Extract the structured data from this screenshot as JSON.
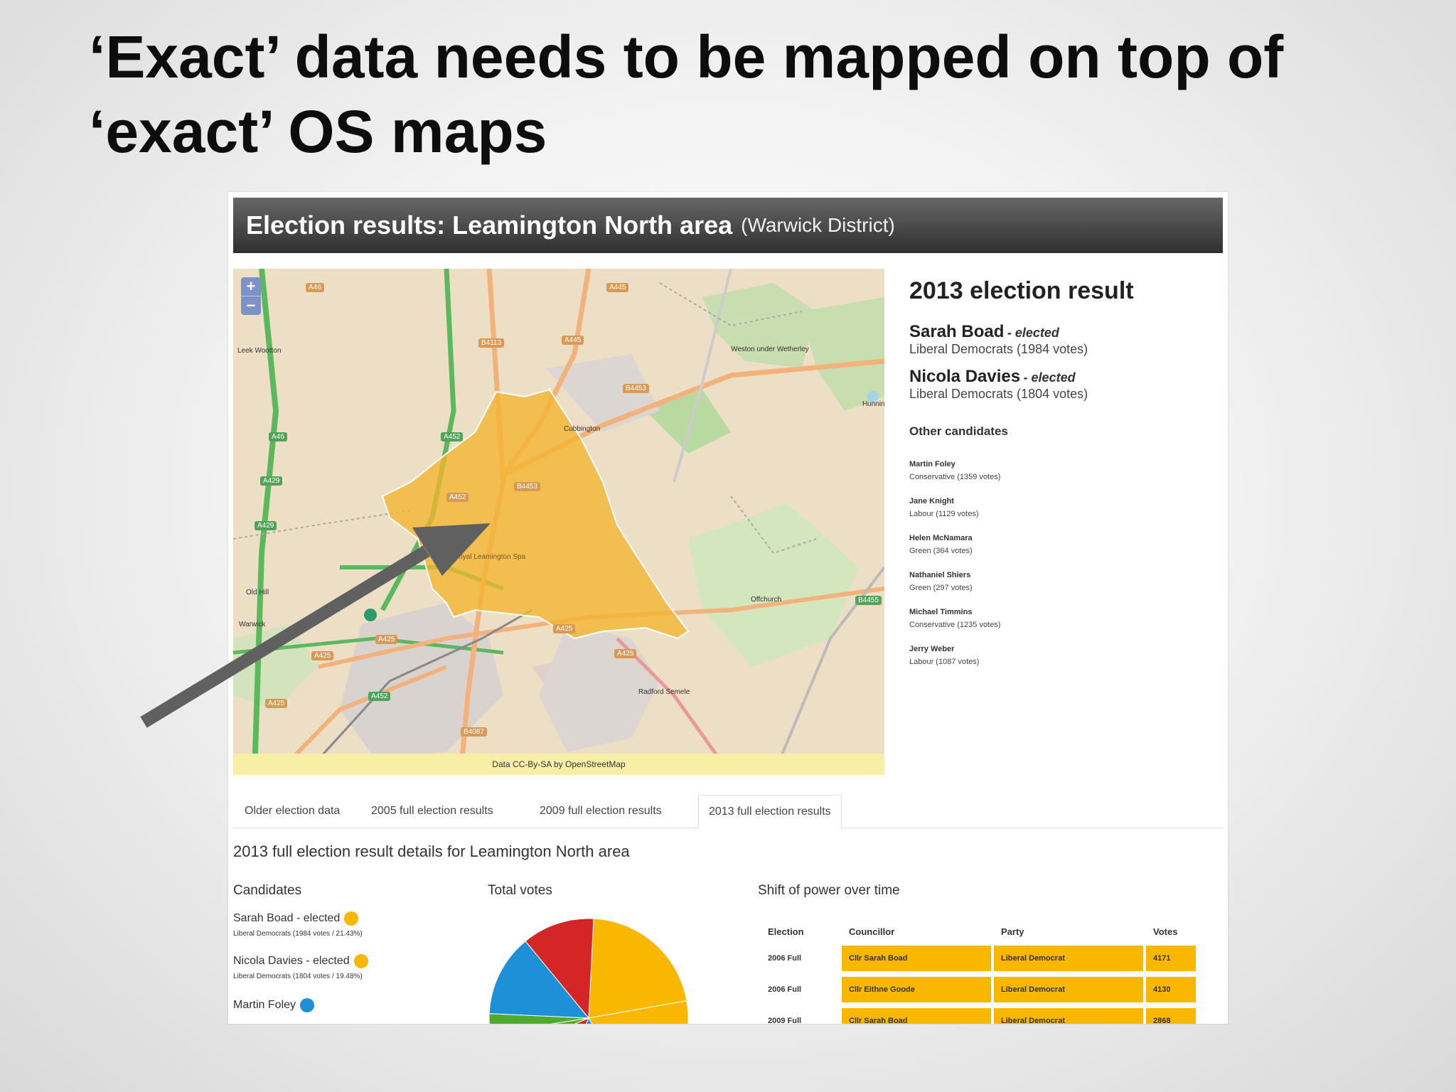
{
  "slide": {
    "title_line1": "‘Exact’ data needs to be mapped on top of",
    "title_line2": "‘exact’ OS maps"
  },
  "header": {
    "title": "Election results: Leamington North area",
    "subtitle": "(Warwick District)"
  },
  "map": {
    "zoom_in": "+",
    "zoom_out": "−",
    "attribution": "Data CC-By-SA by OpenStreetMap",
    "places": [
      "Leek Wootton",
      "Weston under Wetherley",
      "Cubbington",
      "Royal Leamington Spa",
      "Old Hill",
      "Warwick",
      "Offchurch",
      "Radford Semele",
      "Hunningham"
    ],
    "roads": [
      "A46",
      "A445",
      "B4113",
      "A445",
      "B4453",
      "A46",
      "A452",
      "A429",
      "A429",
      "A452",
      "B4453",
      "A425",
      "A425",
      "A425",
      "A425",
      "A452",
      "A425",
      "B4455",
      "B4087"
    ],
    "highlight_color": "#f5b52e"
  },
  "result": {
    "title": "2013 election result",
    "elected": [
      {
        "name": "Sarah Boad",
        "tag": "- elected",
        "party": "Liberal Democrats (1984 votes)"
      },
      {
        "name": "Nicola Davies",
        "tag": "- elected",
        "party": "Liberal Democrats (1804 votes)"
      }
    ],
    "other_heading": "Other candidates",
    "others": [
      {
        "name": "Martin Foley",
        "detail": "Conservative (1359 votes)"
      },
      {
        "name": "Jane Knight",
        "detail": "Labour (1129 votes)"
      },
      {
        "name": "Helen McNamara",
        "detail": "Green (364 votes)"
      },
      {
        "name": "Nathaniel Shiers",
        "detail": "Green (297 votes)"
      },
      {
        "name": "Michael Timmins",
        "detail": "Conservative (1235 votes)"
      },
      {
        "name": "Jerry Weber",
        "detail": "Labour (1087 votes)"
      }
    ]
  },
  "tabs": [
    {
      "label": "Older election data",
      "active": false
    },
    {
      "label": "2005 full election results",
      "active": false
    },
    {
      "label": "2009 full election results",
      "active": false
    },
    {
      "label": "2013 full election results",
      "active": true
    }
  ],
  "details": {
    "title": "2013 full election result details for Leamington North area",
    "col_candidates": "Candidates",
    "col_total_votes": "Total votes",
    "col_shift": "Shift of power over time",
    "candidates": [
      {
        "line": "Sarah Boad - elected",
        "sub": "Liberal Democrats (1984 votes / 21.43%)",
        "color": "#f9b700"
      },
      {
        "line": "Nicola Davies - elected",
        "sub": "Liberal Democrats (1804 votes / 19.48%)",
        "color": "#f9b700"
      },
      {
        "line": "Martin Foley",
        "sub": "",
        "color": "#1e90d8"
      }
    ],
    "power_table": {
      "headers": [
        "Election",
        "Councillor",
        "Party",
        "Votes"
      ],
      "rows": [
        [
          "2006 Full",
          "Cllr Sarah Boad",
          "Liberal Democrat",
          "4171"
        ],
        [
          "2006 Full",
          "Cllr Eithne Goode",
          "Liberal Democrat",
          "4130"
        ],
        [
          "2009 Full",
          "Cllr Sarah Boad",
          "Liberal Democrat",
          "2868"
        ]
      ]
    }
  },
  "chart_data": {
    "type": "pie",
    "title": "Total votes",
    "categories": [
      "Sarah Boad",
      "Nicola Davies",
      "Martin Foley",
      "Jane Knight",
      "Helen McNamara",
      "Nathaniel Shiers",
      "Michael Timmins",
      "Jerry Weber"
    ],
    "values": [
      1984,
      1804,
      1359,
      1129,
      364,
      297,
      1235,
      1087
    ],
    "colors": [
      "#f9b700",
      "#f9b700",
      "#1e90d8",
      "#d42626",
      "#4fab2e",
      "#4fab2e",
      "#1e90d8",
      "#d42626"
    ]
  }
}
